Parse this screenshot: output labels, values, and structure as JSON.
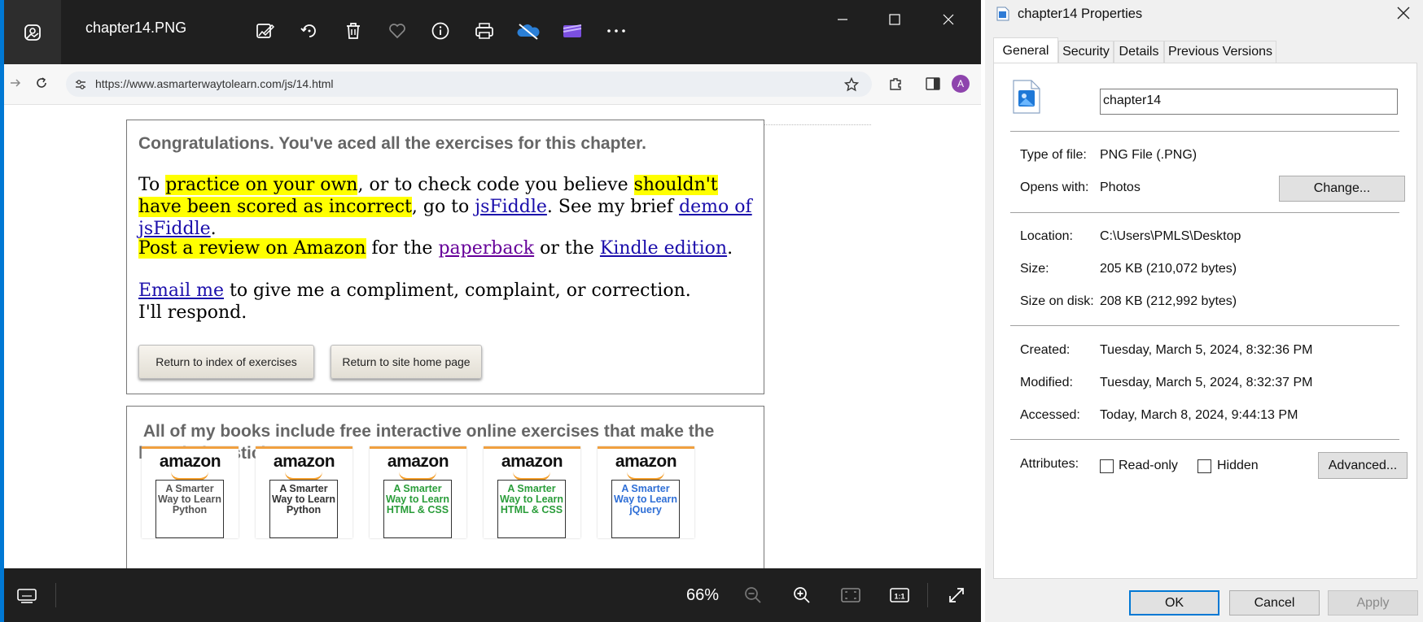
{
  "viewer": {
    "title": "chapter14.PNG",
    "zoom": "66%"
  },
  "browser": {
    "url": "https://www.asmarterwaytolearn.com/js/14.html",
    "profile_initial": "A"
  },
  "page": {
    "congrats": "Congratulations. You've aced all the exercises for this chapter.",
    "p1_a": "To ",
    "p1_hl1": "practice on your own",
    "p1_b": ", or to check code you believe ",
    "p1_hl2": "shouldn't have been scored as incorrect",
    "p1_c": ", go to ",
    "p1_link1": "jsFiddle",
    "p1_d": ". See my brief ",
    "p1_link2": "demo of jsFiddle",
    "p1_e": ".",
    "p2_hl": "Post a review on Amazon",
    "p2_a": " for the ",
    "p2_link1": "paperback",
    "p2_b": " or the ",
    "p2_link2": "Kindle edition",
    "p2_c": ".",
    "p3_link": "Email me",
    "p3_a": " to give me a compliment, complaint, or correction. I'll respond.",
    "btn_index": "Return to index of exercises",
    "btn_home": "Return to site home page",
    "books_heading": " All of my books include free interactive online exercises that make the knowledge stick.",
    "books": [
      {
        "brand": "amazon",
        "cover": "A Smarter Way to Learn Python",
        "color": "#555555"
      },
      {
        "brand": "amazon",
        "cover": "A Smarter Way to Learn Python",
        "color": "#333333"
      },
      {
        "brand": "amazon",
        "cover": "A Smarter Way to Learn HTML & CSS",
        "color": "#2a9d3a"
      },
      {
        "brand": "amazon",
        "cover": "A Smarter Way to Learn HTML & CSS",
        "color": "#2a9d3a"
      },
      {
        "brand": "amazon",
        "cover": "A Smarter Way to Learn jQuery",
        "color": "#2f6fd6"
      }
    ]
  },
  "dialog": {
    "title": "chapter14 Properties",
    "tabs": [
      "General",
      "Security",
      "Details",
      "Previous Versions"
    ],
    "filename": "chapter14",
    "type_label": "Type of file:",
    "type_value": "PNG File (.PNG)",
    "opens_label": "Opens with:",
    "opens_value": "Photos",
    "change_btn": "Change...",
    "location_label": "Location:",
    "location_value": "C:\\Users\\PMLS\\Desktop",
    "size_label": "Size:",
    "size_value": "205 KB (210,072 bytes)",
    "sizedisk_label": "Size on disk:",
    "sizedisk_value": "208 KB (212,992 bytes)",
    "created_label": "Created:",
    "created_value": "Tuesday, March 5, 2024, 8:32:36 PM",
    "modified_label": "Modified:",
    "modified_value": "Tuesday, March 5, 2024, 8:32:37 PM",
    "accessed_label": "Accessed:",
    "accessed_value": "Today, March 8, 2024, 9:44:13 PM",
    "attributes_label": "Attributes:",
    "readonly_label": "Read-only",
    "hidden_label": "Hidden",
    "advanced_btn": "Advanced...",
    "ok_btn": "OK",
    "cancel_btn": "Cancel",
    "apply_btn": "Apply"
  },
  "colors": {
    "accent": "#0078d4",
    "highlight": "#ffff00",
    "heading_gray": "#666666"
  }
}
